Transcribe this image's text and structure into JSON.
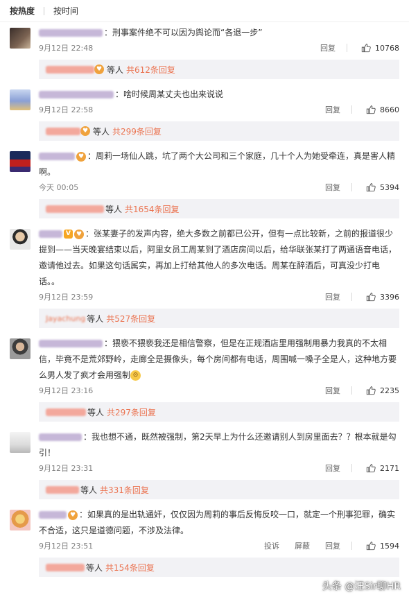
{
  "sort": {
    "hot": "按热度",
    "time": "按时间"
  },
  "labels": {
    "reply": "回复",
    "report": "投诉",
    "block": "屏蔽",
    "etc": "等人"
  },
  "colors": {
    "accent": "#eb7350",
    "meta": "#808080"
  },
  "comments": [
    {
      "text": "：刑事案件绝不可以因为舆论而“各退一步”",
      "time": "9月12日 22:48",
      "likes": "10768",
      "reply_count": "共612条回复"
    },
    {
      "text": "：啥时候周某丈夫也出来说说",
      "time": "9月12日 22:58",
      "likes": "8660",
      "reply_count": "共299条回复"
    },
    {
      "text": "：周莉一场仙人跳，坑了两个大公司和三个家庭，几十个人为她受牵连，真是害人精啊。",
      "time": "今天 00:05",
      "likes": "5394",
      "reply_count": "共1654条回复"
    },
    {
      "text": "：张某妻子的发声内容，绝大多数之前都已公开，但有一点比较新，之前的报道很少提到——当天晚宴结束以后，阿里女员工周某到了酒店房间以后，给华联张某打了两通语音电话，邀请他过去。如果这句话属实，再加上打给其他人的多次电话。周某在醉酒后，可真没少打电话。。",
      "time": "9月12日 23:59",
      "likes": "3396",
      "reply_count_user": "Jayachung",
      "reply_count": "共527条回复"
    },
    {
      "text": "：猥亵不猥亵我还是相信警察，但是在正规酒店里用强制用暴力我真的不太相信，毕竟不是荒郊野岭，走廊全是摄像头，每个房间都有电话，周围喊一嗓子全是人，这种地方要么男人发了疯才会用强制",
      "time": "9月12日 23:16",
      "likes": "2235",
      "reply_count": "共297条回复"
    },
    {
      "text": "：我也想不通，既然被强制，第2天早上为什么还邀请别人到房里面去？？根本就是勾引！",
      "time": "9月12日 23:31",
      "likes": "2171",
      "reply_count": "共331条回复"
    },
    {
      "text": "：如果真的是出轨通奸，仅仅因为周莉的事后反悔反咬一口，就定一个刑事犯罪，确实不合适，这只是道德问题，不涉及法律。",
      "time": "9月12日 23:51",
      "likes": "1594",
      "reply_count": "共154条回复"
    }
  ],
  "watermark": "头条 @汪Sir聊HR"
}
